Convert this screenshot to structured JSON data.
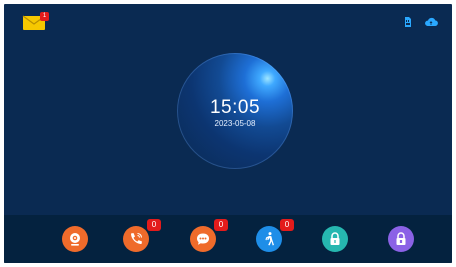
{
  "status": {
    "mail_badge": "1",
    "icons": [
      "mail-icon",
      "sd-card-icon",
      "cloud-icon"
    ]
  },
  "clock": {
    "time": "15:05",
    "date": "2023-05-08"
  },
  "dock": {
    "items": [
      {
        "name": "camera-monitor",
        "icon": "webcam-icon",
        "color": "#ef6b2b",
        "badge": null
      },
      {
        "name": "call-log",
        "icon": "phone-icon",
        "color": "#ef6b2b",
        "badge": "0"
      },
      {
        "name": "messages",
        "icon": "chat-icon",
        "color": "#ef6b2b",
        "badge": "0"
      },
      {
        "name": "motion-detection",
        "icon": "walking-person-icon",
        "color": "#1e8ee8",
        "badge": "0"
      },
      {
        "name": "unlock-1",
        "icon": "lock-icon",
        "color": "#26b7b0",
        "badge": null
      },
      {
        "name": "unlock-2",
        "icon": "lock-icon",
        "color": "#8b62e6",
        "badge": null
      }
    ]
  },
  "colors": {
    "background": "#0a2a52",
    "dock": "#04223f",
    "badge": "#e31b1b",
    "accent_blue": "#2aa8ff"
  }
}
